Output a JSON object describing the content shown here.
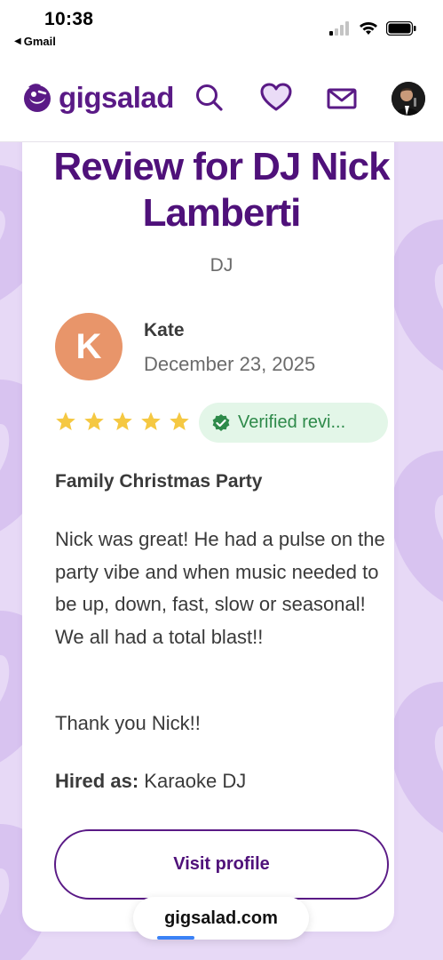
{
  "status_bar": {
    "time": "10:38",
    "back_app": "Gmail"
  },
  "header": {
    "logo_text": "gigsalad",
    "icons": [
      "search-icon",
      "heart-icon",
      "mail-icon",
      "profile-avatar"
    ]
  },
  "review": {
    "title": "Review for DJ Nick Lamberti",
    "category": "DJ",
    "reviewer": {
      "initial": "K",
      "name": "Kate",
      "date": "December 23, 2025"
    },
    "rating": 5,
    "verified_label": "Verified revi...",
    "event_title": "Family Christmas Party",
    "body": "Nick was great! He had a pulse on the party vibe and when music needed to be up, down, fast, slow or seasonal! We all had a total blast!!",
    "thanks": "Thank you Nick!!",
    "hired_label": "Hired as:",
    "hired_value": "Karaoke DJ",
    "visit_button": "Visit profile"
  },
  "browser": {
    "url": "gigsalad.com"
  },
  "colors": {
    "brand": "#5a1a86",
    "background": "#e7d9f6",
    "star": "#f5c842",
    "verified_bg": "#e3f6e8",
    "verified_text": "#2e8a4a",
    "avatar": "#e8956a"
  }
}
